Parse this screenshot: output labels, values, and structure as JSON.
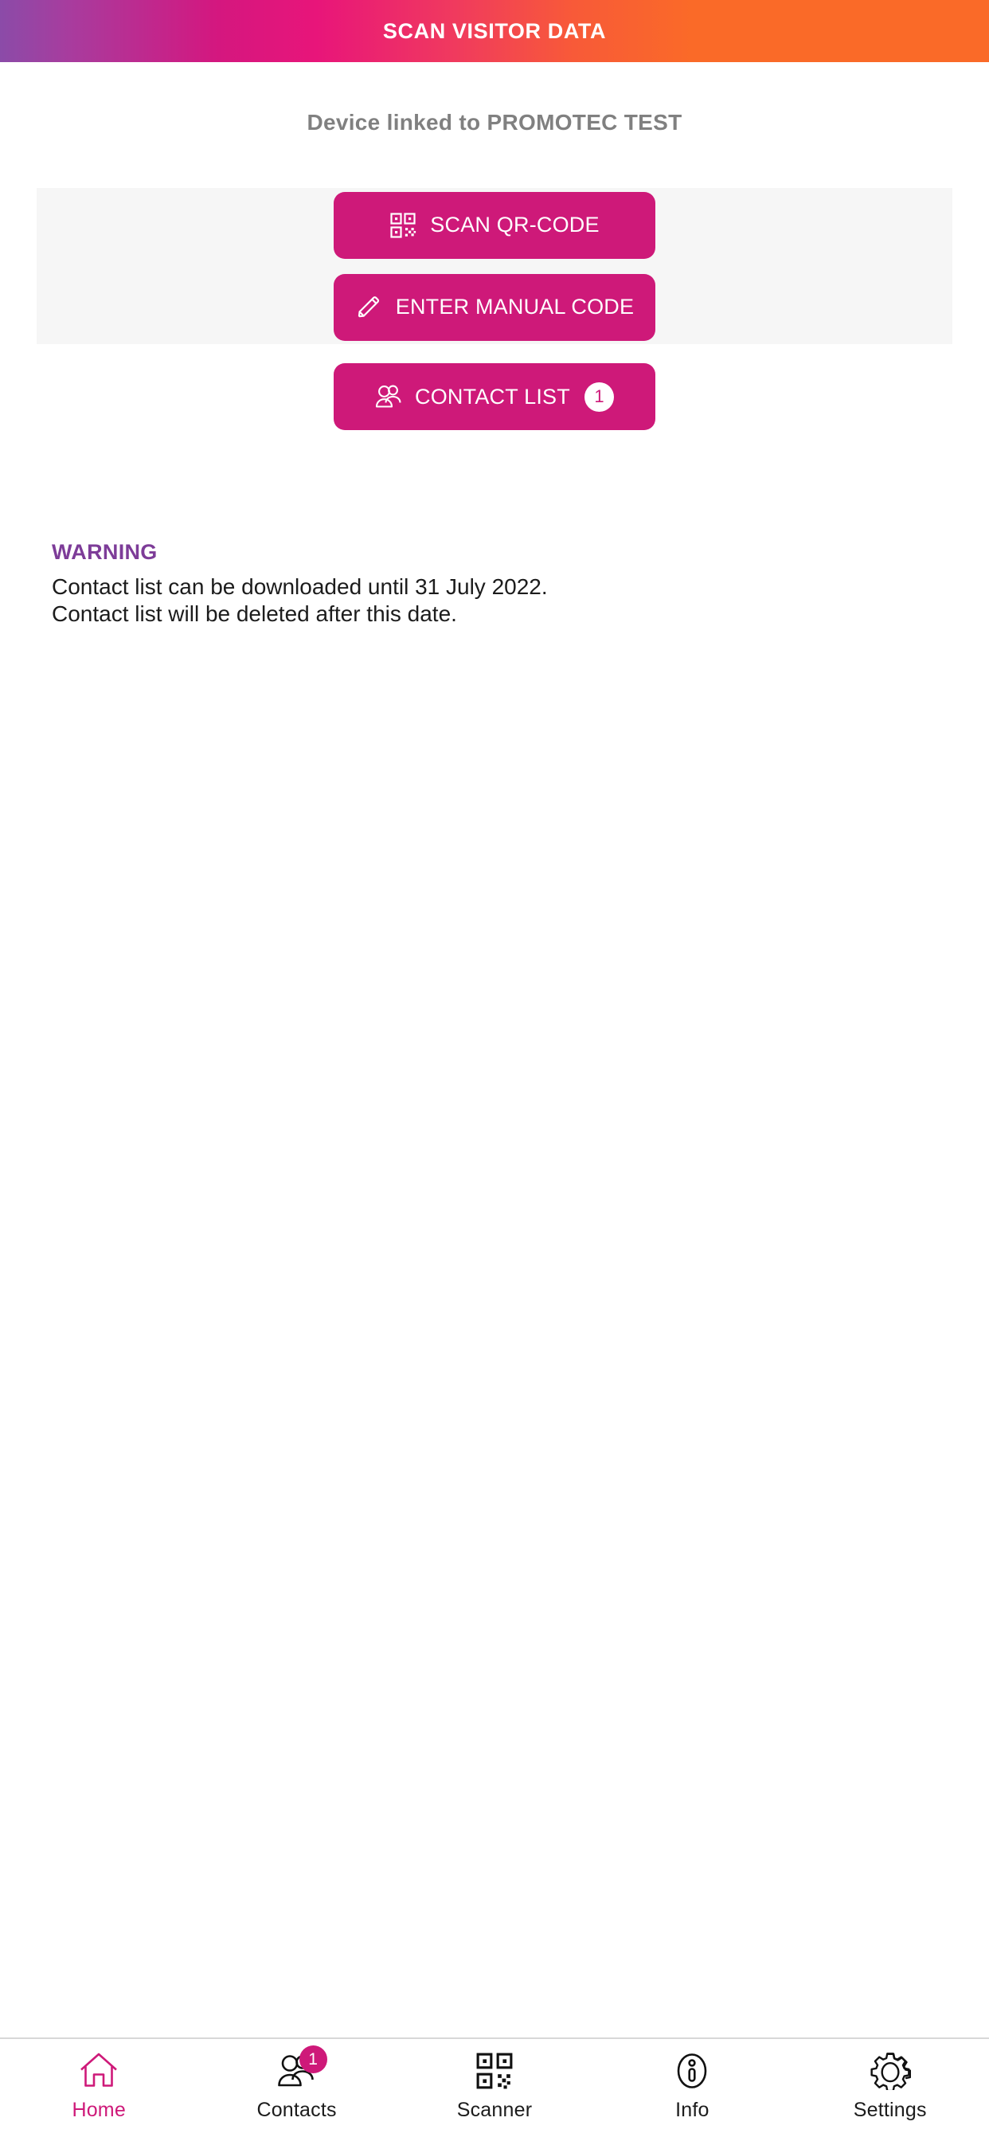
{
  "header": {
    "title": "SCAN VISITOR DATA",
    "gradient_start": "#8B4BA8",
    "gradient_mid": "#E8157A",
    "gradient_end": "#FA6A28"
  },
  "subtitle": "Device linked to PROMOTEC TEST",
  "colors": {
    "primary_pink": "#CE1979",
    "warning_purple": "#7D3C98",
    "card_bg": "#F6F6F6",
    "subtitle_gray": "#808080"
  },
  "actions": {
    "scan_qr_label": "SCAN QR-CODE",
    "scan_qr_icon": "qr-code-icon",
    "manual_code_label": "ENTER MANUAL CODE",
    "manual_code_icon": "pencil-icon"
  },
  "contact_list": {
    "label": "CONTACT LIST",
    "icon": "people-icon",
    "count": "1"
  },
  "warning": {
    "title": "WARNING",
    "line1": "Contact list can be downloaded until 31 July 2022.",
    "line2": "Contact list will be deleted after this date."
  },
  "bottom_nav": {
    "items": [
      {
        "label": "Home",
        "icon": "home-icon",
        "active": true,
        "badge": ""
      },
      {
        "label": "Contacts",
        "icon": "people-icon",
        "active": false,
        "badge": "1"
      },
      {
        "label": "Scanner",
        "icon": "qr-code-icon",
        "active": false,
        "badge": ""
      },
      {
        "label": "Info",
        "icon": "info-icon",
        "active": false,
        "badge": ""
      },
      {
        "label": "Settings",
        "icon": "gear-icon",
        "active": false,
        "badge": ""
      }
    ]
  }
}
